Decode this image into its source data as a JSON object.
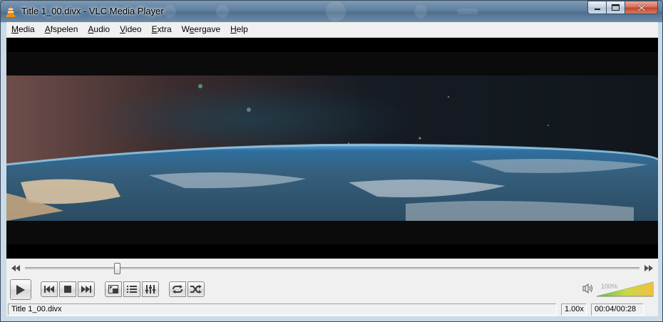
{
  "window": {
    "title": "Title 1_00.divx - VLC Media Player"
  },
  "menu": {
    "items": [
      {
        "id": "media",
        "accel": "M",
        "rest": "edia"
      },
      {
        "id": "afspelen",
        "accel": "A",
        "rest": "fspelen"
      },
      {
        "id": "audio",
        "accel": "A",
        "rest": "udio"
      },
      {
        "id": "video",
        "accel": "V",
        "rest": "ideo"
      },
      {
        "id": "extra",
        "accel": "E",
        "rest": "xtra"
      },
      {
        "id": "weergave",
        "pre": "W",
        "accel": "e",
        "rest": "ergave"
      },
      {
        "id": "help",
        "accel": "H",
        "rest": "elp"
      }
    ]
  },
  "playback": {
    "position_fraction": 0.15
  },
  "volume": {
    "percent_label": "100%",
    "level_fraction": 1.0
  },
  "status": {
    "media_title": "Title 1_00.divx",
    "speed": "1.00x",
    "time": "00:04/00:28"
  },
  "icons": {
    "app": "vlc-cone-icon",
    "play": "play-icon",
    "previous": "previous-icon",
    "stop": "stop-icon",
    "next": "next-icon",
    "fullscreen": "fullscreen-icon",
    "playlist": "playlist-icon",
    "extended": "extended-settings-icon",
    "loop": "loop-icon",
    "random": "shuffle-icon",
    "speaker": "speaker-icon"
  }
}
